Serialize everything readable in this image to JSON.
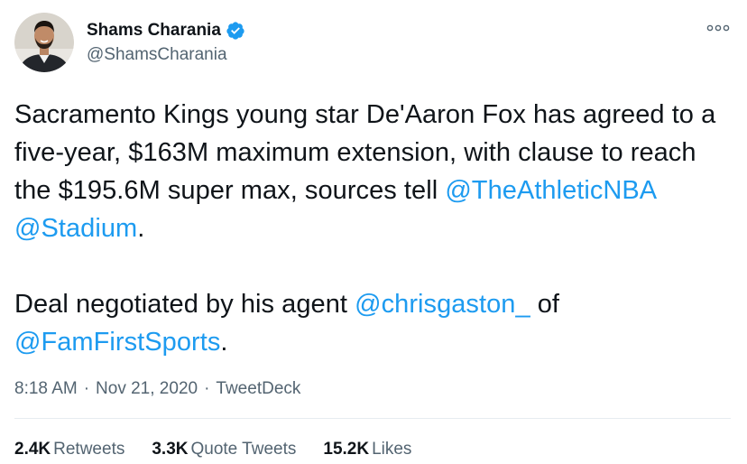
{
  "author": {
    "display_name": "Shams Charania",
    "handle": "@ShamsCharania",
    "verified": true,
    "avatar_icon": "profile-photo-icon",
    "verified_icon": "verified-badge-icon",
    "more_icon": "more-options-icon"
  },
  "tweet": {
    "paragraph1": {
      "text": "Sacramento Kings young star De'Aaron Fox has agreed to a five-year, $163M maximum extension, with clause to reach the $195.6M super max, sources tell ",
      "mention1": "@TheAthleticNBA",
      "sep": " ",
      "mention2": "@Stadium",
      "end": "."
    },
    "paragraph2": {
      "text": "Deal negotiated by his agent ",
      "mention1": "@chrisgaston_",
      "mid": " of ",
      "mention2": "@FamFirstSports",
      "end": "."
    }
  },
  "meta": {
    "time": "8:18 AM",
    "separator": "·",
    "date": "Nov 21, 2020",
    "source": "TweetDeck"
  },
  "stats": {
    "retweets_count": "2.4K",
    "retweets_label": "Retweets",
    "quotes_count": "3.3K",
    "quotes_label": "Quote Tweets",
    "likes_count": "15.2K",
    "likes_label": "Likes"
  },
  "colors": {
    "accent": "#1d9bf0",
    "text": "#0f1419",
    "secondary": "#536471",
    "divider": "#e6ecf0"
  }
}
